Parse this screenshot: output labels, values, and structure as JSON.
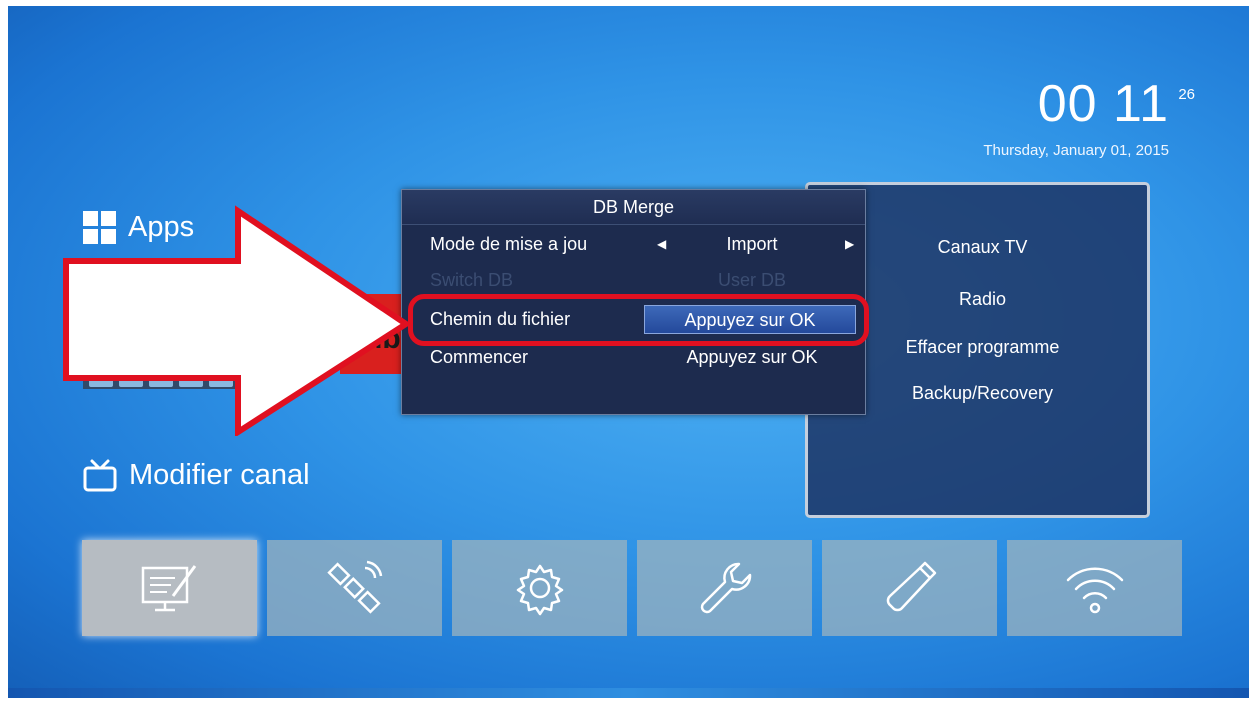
{
  "clock": {
    "hour": "00",
    "minute": "11",
    "second": "26",
    "date": "Thursday, January 01, 2015"
  },
  "sections": {
    "apps": "Apps",
    "modifier": "Modifier canal"
  },
  "youtube_text": "Tub",
  "dialog": {
    "title": "DB Merge",
    "rows": [
      {
        "label": "Mode de mise a jou",
        "value": "Import"
      },
      {
        "label": "Switch DB",
        "value": "User DB"
      },
      {
        "label": "Chemin du fichier",
        "value": "Appuyez sur OK"
      },
      {
        "label": "Commencer",
        "value": "Appuyez sur OK"
      }
    ]
  },
  "right_menu": [
    "Canaux TV",
    "Radio",
    "Effacer programme",
    "Backup/Recovery"
  ],
  "toolbar": [
    "edit-channel-icon",
    "satellite-icon",
    "settings-gear-icon",
    "wrench-icon",
    "usb-drive-icon",
    "wifi-icon"
  ],
  "colors": {
    "highlight_red": "#e01020",
    "selected_blue": "#2e57aa",
    "panel_dark": "#1d2b4e"
  }
}
